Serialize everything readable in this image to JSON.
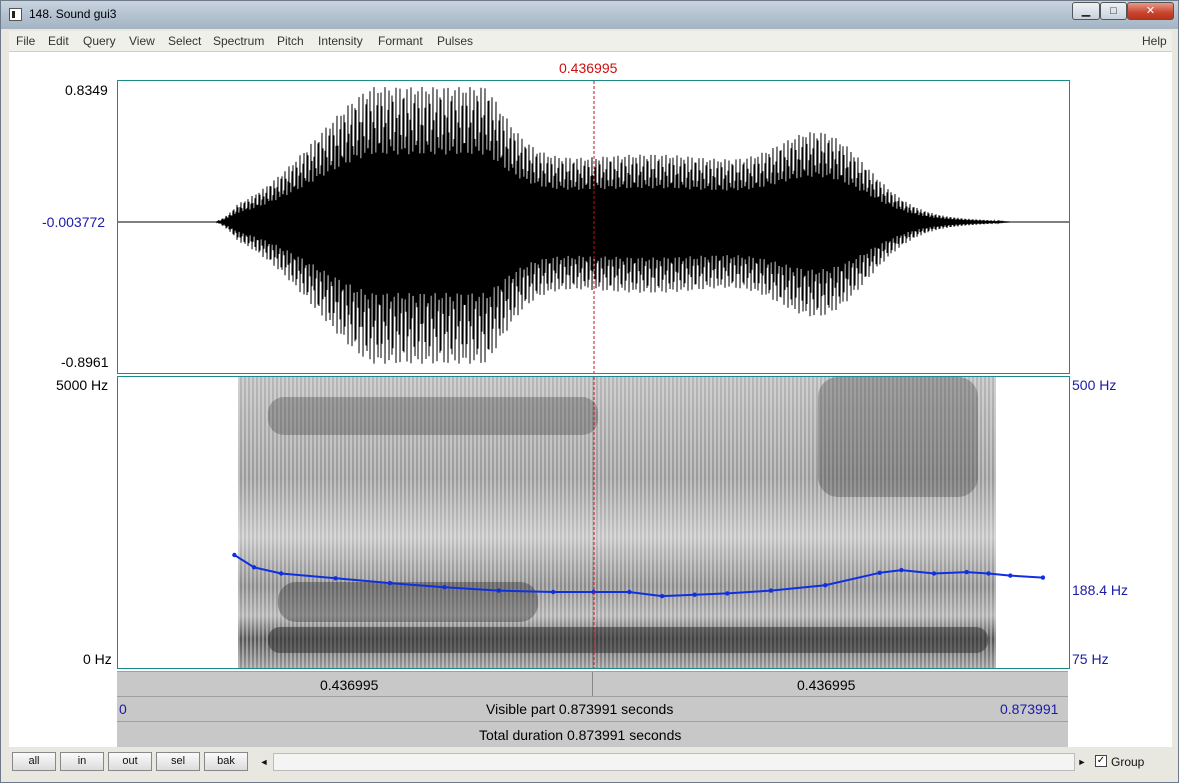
{
  "window": {
    "title": "148. Sound gui3",
    "controls": {
      "minimize": "▁",
      "maximize": "□",
      "close": "✕"
    }
  },
  "menu": [
    "File",
    "Edit",
    "Query",
    "View",
    "Select",
    "Spectrum",
    "Pitch",
    "Intensity",
    "Formant",
    "Pulses"
  ],
  "help": "Help",
  "cursor": {
    "time_label": "0.436995",
    "time": 0.436995
  },
  "waveform": {
    "y_max": "0.8349",
    "y_mid": "-0.003772",
    "y_min": "-0.8961"
  },
  "spectrogram": {
    "freq_max": "5000 Hz",
    "freq_min": "0 Hz",
    "pitch_top": "500 Hz",
    "pitch_cursor": "188.4 Hz",
    "pitch_bottom": "75 Hz"
  },
  "pitch_contour": {
    "time": [
      0.107,
      0.125,
      0.15,
      0.2,
      0.25,
      0.3,
      0.35,
      0.4,
      0.437,
      0.47,
      0.5,
      0.53,
      0.56,
      0.6,
      0.65,
      0.7,
      0.72,
      0.75,
      0.78,
      0.8,
      0.82,
      0.85
    ],
    "hz": [
      240,
      222,
      213,
      206,
      199,
      193,
      188,
      186,
      186,
      186,
      180,
      182,
      184,
      188,
      196,
      214,
      218,
      213,
      215,
      213,
      210,
      207
    ]
  },
  "time_axis": {
    "left_segment": "0.436995",
    "right_segment": "0.436995",
    "visible_start": "0",
    "visible_label": "Visible part 0.873991 seconds",
    "visible_end": "0.873991",
    "total_label": "Total duration 0.873991 seconds"
  },
  "bottom": {
    "buttons": [
      "all",
      "in",
      "out",
      "sel",
      "bak"
    ],
    "scroll_left": "◄",
    "scroll_right": "►",
    "group_check": "✓",
    "group_label": "Group"
  },
  "colors": {
    "accent_red": "#cc1010",
    "axis_blue": "#1a1aa8",
    "pitch_line": "#1030e0"
  }
}
